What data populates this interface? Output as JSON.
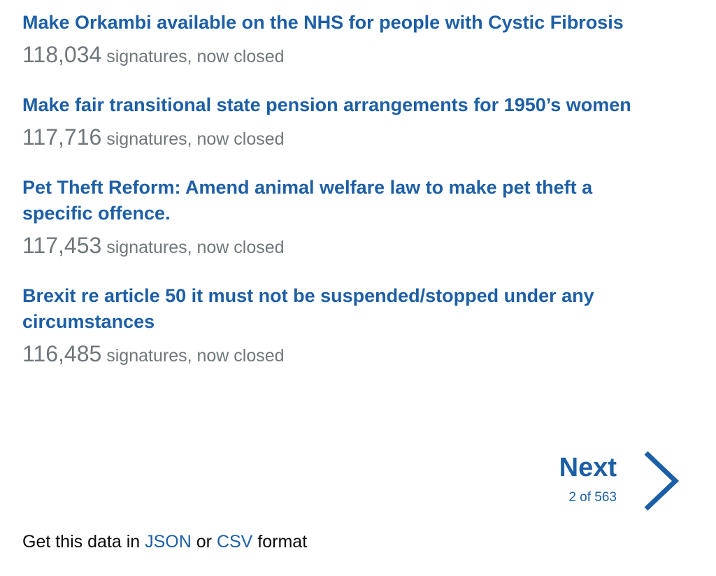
{
  "petitions": [
    {
      "title": "Make Orkambi available on the NHS for people with Cystic Fibrosis",
      "count": "118,034",
      "status": "signatures, now closed"
    },
    {
      "title": "Make fair transitional state pension arrangements for 1950’s women",
      "count": "117,716",
      "status": "signatures, now closed"
    },
    {
      "title": "Pet Theft Reform: Amend animal welfare law to make pet theft a specific offence.",
      "count": "117,453",
      "status": "signatures, now closed"
    },
    {
      "title": "Brexit re article 50 it must not be suspended/stopped under any circumstances",
      "count": "116,485",
      "status": "signatures, now closed"
    }
  ],
  "pagination": {
    "next_label": "Next",
    "page_info": "2 of 563"
  },
  "footer": {
    "prefix": "Get this data in",
    "json_label": "JSON",
    "or_text": "or",
    "csv_label": "CSV",
    "suffix": "format"
  },
  "colors": {
    "link": "#1d5fa6",
    "muted": "#6f777b",
    "text": "#0b0c0c"
  },
  "icons": {
    "next": "chevron-right-icon"
  }
}
